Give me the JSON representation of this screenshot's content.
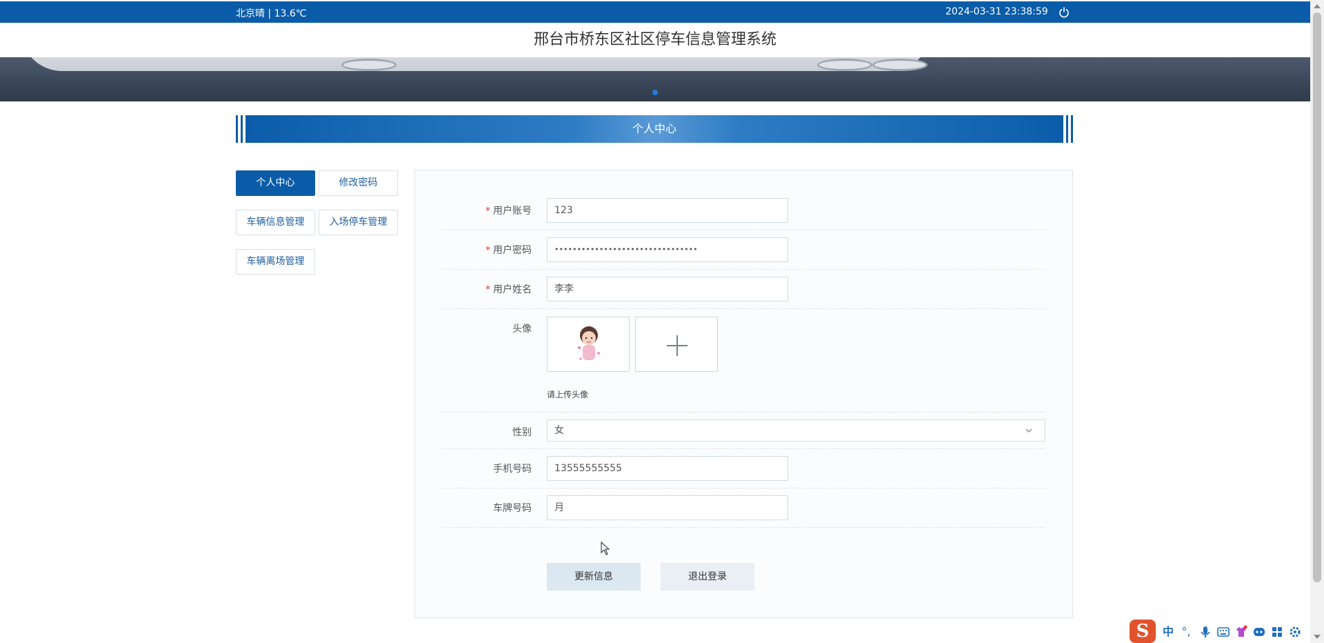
{
  "topbar": {
    "weather": "北京晴 | 13.6℃",
    "datetime": "2024-03-31   23:38:59",
    "power_icon": "power-icon"
  },
  "site_title": "邢台市桥东区社区停车信息管理系统",
  "section_title": "个人中心",
  "sidebar": {
    "items": [
      {
        "label": "个人中心",
        "active": true
      },
      {
        "label": "修改密码",
        "active": false
      },
      {
        "label": "车辆信息管理",
        "active": false
      },
      {
        "label": "入场停车管理",
        "active": false
      },
      {
        "label": "车辆离场管理",
        "active": false
      }
    ]
  },
  "form": {
    "account": {
      "label": "用户账号",
      "required": true,
      "value": "123"
    },
    "password": {
      "label": "用户密码",
      "required": true,
      "value": "••••••••••••••••••••••••••••••••"
    },
    "name": {
      "label": "用户姓名",
      "required": true,
      "value": "李李"
    },
    "avatar": {
      "label": "头像",
      "hint": "请上传头像"
    },
    "gender": {
      "label": "性别",
      "value": "女"
    },
    "phone": {
      "label": "手机号码",
      "value": "13555555555"
    },
    "plate": {
      "label": "车牌号码",
      "value": "月"
    }
  },
  "buttons": {
    "update": "更新信息",
    "logout": "退出登录"
  },
  "colors": {
    "primary": "#0b5ca8",
    "required": "#e33333"
  },
  "ime": {
    "logo": "S",
    "mode": "中",
    "punct": "°,"
  }
}
